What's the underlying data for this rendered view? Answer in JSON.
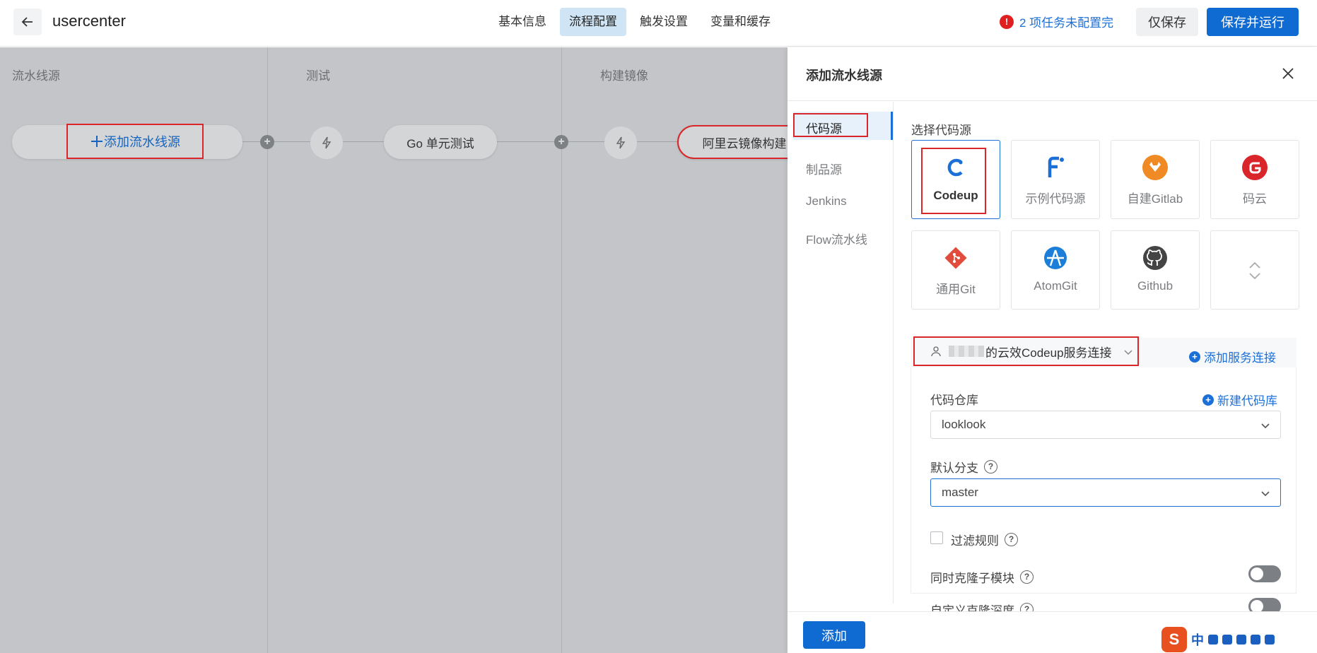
{
  "header": {
    "title": "usercenter",
    "tabs": [
      {
        "label": "基本信息"
      },
      {
        "label": "流程配置",
        "active": true
      },
      {
        "label": "触发设置"
      },
      {
        "label": "变量和缓存"
      }
    ],
    "warning": "2 项任务未配置完",
    "save_only": "仅保存",
    "save_run": "保存并运行"
  },
  "canvas": {
    "stages": [
      {
        "label": "流水线源"
      },
      {
        "label": "测试"
      },
      {
        "label": "构建镜像"
      }
    ],
    "add_source": "添加流水线源",
    "jobs": [
      {
        "label": "Go 单元测试"
      },
      {
        "label": "阿里云镜像构建"
      }
    ]
  },
  "drawer": {
    "title": "添加流水线源",
    "nav": [
      {
        "label": "代码源",
        "active": true
      },
      {
        "label": "制品源"
      },
      {
        "label": "Jenkins"
      },
      {
        "label": "Flow流水线"
      }
    ],
    "select_source_label": "选择代码源",
    "sources": [
      {
        "label": "Codeup",
        "icon": "codeup-icon",
        "color": "#1b6fd6",
        "selected": true
      },
      {
        "label": "示例代码源",
        "icon": "sample-source-icon",
        "color": "#1b6fd6"
      },
      {
        "label": "自建Gitlab",
        "icon": "gitlab-icon",
        "color": "#f08a24"
      },
      {
        "label": "码云",
        "icon": "gitee-icon",
        "color": "#d9262a"
      },
      {
        "label": "通用Git",
        "icon": "git-icon",
        "color": "#e24c3d"
      },
      {
        "label": "AtomGit",
        "icon": "atomgit-icon",
        "color": "#1b7fd9"
      },
      {
        "label": "Github",
        "icon": "github-icon",
        "color": "#444"
      },
      {
        "label": "",
        "icon": "expand-icon",
        "color": "#999"
      }
    ],
    "connection": {
      "prefix_visible": "",
      "value": "的云效Codeup服务连接",
      "add_label": "添加服务连接"
    },
    "repo": {
      "label": "代码仓库",
      "add_label": "新建代码库",
      "value": "looklook"
    },
    "branch": {
      "label": "默认分支",
      "value": "master"
    },
    "filter_label": "过滤规则",
    "submodule_label": "同时克隆子模块",
    "depth_label": "自定义克隆深度",
    "add_button": "添加"
  },
  "ime": {
    "text": "中"
  }
}
